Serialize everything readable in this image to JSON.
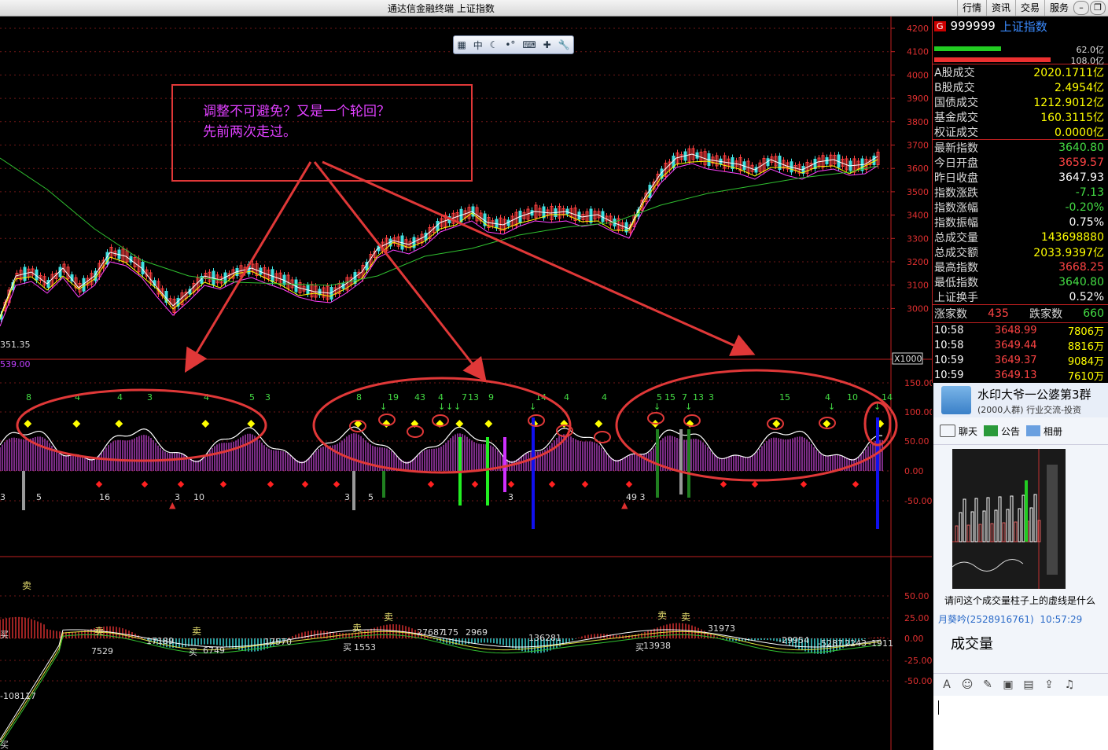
{
  "window": {
    "title": "通达信金融终端   上证指数",
    "menu": [
      "行情",
      "资讯",
      "交易",
      "服务"
    ]
  },
  "toolbar": {
    "zh_label": "中"
  },
  "annotation": {
    "line1": "调整不可避免？又是一个轮回？",
    "line2": "先前两次走过。",
    "color": "#e03838"
  },
  "price_axis": [
    "4200",
    "4100",
    "4000",
    "3900",
    "3800",
    "3700",
    "3600",
    "3500",
    "3400",
    "3300",
    "3200",
    "3100",
    "3000"
  ],
  "price_low_label": "351.35",
  "mid_scale_label": "X1000",
  "osc_axis": [
    "150.00",
    "100.00",
    "50.00",
    "0.00",
    "-50.00"
  ],
  "osc_top_label": "539.00",
  "macd_axis": [
    "50.00",
    "25.00",
    "0.00",
    "-25.00",
    "-50.00"
  ],
  "counts_top": [
    "8",
    "4",
    "4",
    "3",
    "4",
    "5",
    "3",
    "8",
    "19",
    "43",
    "4",
    "7",
    "13",
    "9",
    "14",
    "4",
    "4",
    "5",
    "15",
    "7",
    "13",
    "3",
    "15",
    "4",
    "10",
    "14"
  ],
  "counts_bottom": [
    "3",
    "5",
    "16",
    "3",
    "10",
    "3",
    "5",
    "3",
    "49 3"
  ],
  "macd_labels": [
    "-108117",
    "7529",
    "17189",
    "6749",
    "17570",
    "1553",
    "27687",
    "175",
    "2969",
    "136281",
    "13938",
    "31973",
    "-29954",
    "-5287",
    "2243",
    "-1911"
  ],
  "sell_label": "卖",
  "buy_label": "买",
  "info": {
    "code": "999999",
    "name": "上证指数",
    "g": "G",
    "bar1": "62.0亿",
    "bar2": "108.0亿",
    "rows1": [
      {
        "k": "A股成交",
        "v": "2020.1711亿",
        "c": "#ffff00"
      },
      {
        "k": "B股成交",
        "v": "2.4954亿",
        "c": "#ffff00"
      },
      {
        "k": "国债成交",
        "v": "1212.9012亿",
        "c": "#ffff00"
      },
      {
        "k": "基金成交",
        "v": "160.3115亿",
        "c": "#ffff00"
      },
      {
        "k": "权证成交",
        "v": "0.0000亿",
        "c": "#ffff00"
      }
    ],
    "rows2": [
      {
        "k": "最新指数",
        "v": "3640.80",
        "c": "#44dd44"
      },
      {
        "k": "今日开盘",
        "v": "3659.57",
        "c": "#ff4444"
      },
      {
        "k": "昨日收盘",
        "v": "3647.93",
        "c": "#ffffff"
      },
      {
        "k": "指数涨跌",
        "v": "-7.13",
        "c": "#44dd44"
      },
      {
        "k": "指数涨幅",
        "v": "-0.20%",
        "c": "#44dd44"
      },
      {
        "k": "指数振幅",
        "v": "0.75%",
        "c": "#ffffff"
      },
      {
        "k": "总成交量",
        "v": "143698880",
        "c": "#ffff00"
      },
      {
        "k": "总成交额",
        "v": "2033.9397亿",
        "c": "#ffff00"
      },
      {
        "k": "最高指数",
        "v": "3668.25",
        "c": "#ff4444"
      },
      {
        "k": "最低指数",
        "v": "3640.80",
        "c": "#44dd44"
      },
      {
        "k": "上证换手",
        "v": "0.52%",
        "c": "#ffffff"
      }
    ],
    "up_label": "涨家数",
    "up_value": "435",
    "down_label": "跌家数",
    "down_value": "660",
    "ticks": [
      {
        "t": "10:58",
        "p": "3648.99",
        "v": "7806万"
      },
      {
        "t": "10:58",
        "p": "3649.44",
        "v": "8816万"
      },
      {
        "t": "10:59",
        "p": "3649.37",
        "v": "9084万"
      },
      {
        "t": "10:59",
        "p": "3649.13",
        "v": "7610万"
      }
    ]
  },
  "chat": {
    "group_name": "水印大爷一公婆第3群",
    "group_sub": "(2000人群) 行业交流-投资",
    "tabs": [
      "聊天",
      "公告",
      "相册"
    ],
    "message": "请问这个成交量柱子上的虚线是什么",
    "sender": "月葵吟(2528916761)",
    "time": "10:57:29",
    "big_text": "成交量"
  }
}
